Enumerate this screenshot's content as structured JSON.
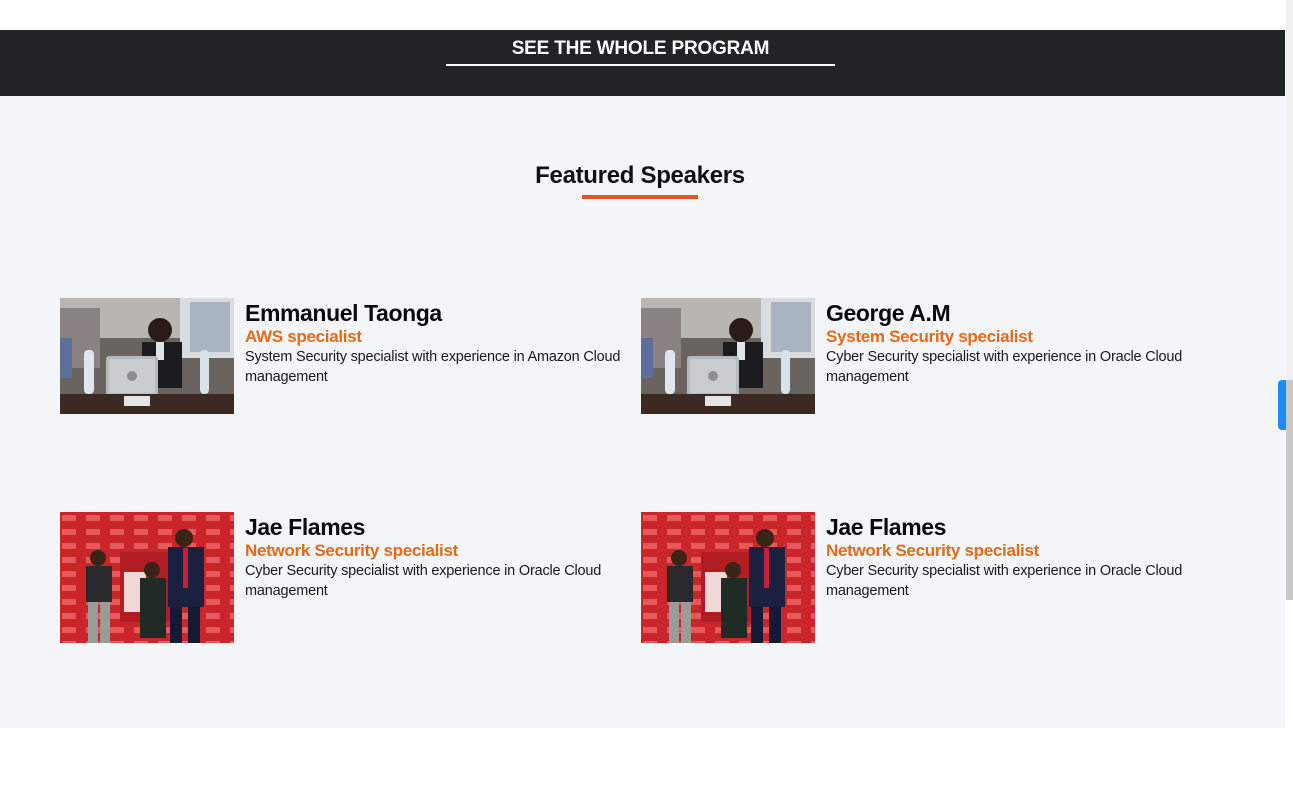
{
  "program_link": "SEE THE WHOLE PROGRAM",
  "section_title": "Featured Speakers",
  "speakers": [
    {
      "name": "Emmanuel Taonga",
      "role": "AWS specialist",
      "bio": "System Security specialist with experience in Amazon Cloud management",
      "photo": "office-meeting-photo"
    },
    {
      "name": "George A.M",
      "role": "System Security specialist",
      "bio": "Cyber Security specialist with experience in Oracle Cloud management",
      "photo": "office-meeting-photo"
    },
    {
      "name": "Jae Flames",
      "role": "Network Security specialist",
      "bio": "Cyber Security specialist with experience in Oracle Cloud management",
      "photo": "red-backdrop-group-photo"
    },
    {
      "name": "Jae Flames",
      "role": "Network Security specialist",
      "bio": "Cyber Security specialist with experience in Oracle Cloud management",
      "photo": "red-backdrop-group-photo"
    }
  ],
  "colors": {
    "accent": "#e8541e",
    "role_text": "#e66a17",
    "dark_band": "#202425",
    "section_bg": "#f4f5f9",
    "scroll_thumb": "#1a8cff"
  }
}
